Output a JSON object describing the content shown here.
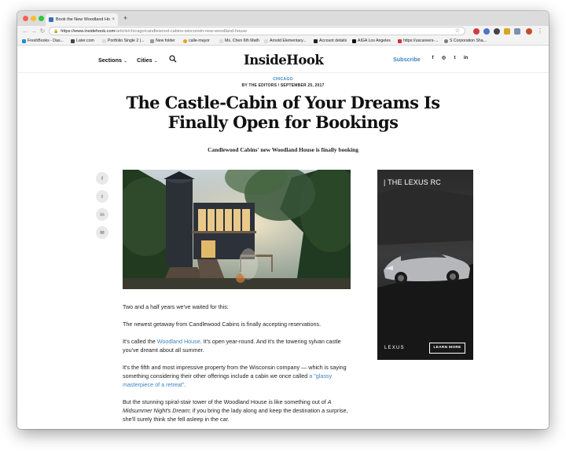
{
  "browser": {
    "tab_title": "Book the New Woodland House",
    "tab_close": "×",
    "new_tab": "+",
    "url_host": "https://www.insidehook.com",
    "url_path": "/article/chicago/candlewood-cabins-wisconsin-new-woodland-house",
    "bookmarks": [
      {
        "label": "FreshBooks - Das...",
        "color": "#1f8fd8"
      },
      {
        "label": "Later.com",
        "color": "#444444"
      },
      {
        "label": "Portfolio Single 2 |...",
        "color": "#bbbbbb"
      },
      {
        "label": "New folder",
        "color": "#9a9a9a"
      },
      {
        "label": "calle-mayor",
        "color": "#e6a21b"
      },
      {
        "label": "Ms. Chen 6th Math",
        "color": "#bbbbbb"
      },
      {
        "label": "Arnold Elementary...",
        "color": "#bbbbbb"
      },
      {
        "label": "Account details",
        "color": "#222222"
      },
      {
        "label": "AIGA Los Angeles",
        "color": "#111111"
      },
      {
        "label": "https://uscareers-...",
        "color": "#d0342c"
      },
      {
        "label": "S Corporation Sha...",
        "color": "#7a7a7a"
      }
    ]
  },
  "site": {
    "nav": {
      "sections": "Sections",
      "cities": "Cities"
    },
    "logo": "InsideHook",
    "subscribe": "Subscribe",
    "social": [
      "f",
      "◎",
      "t",
      "in"
    ]
  },
  "article": {
    "category": "CHICAGO",
    "byline": "BY THE EDITORS / SEPTEMBER 25, 2017",
    "headline": "The Castle-Cabin of Your Dreams Is Finally Open for Bookings",
    "dek": "Candlewood Cabins' new Woodland House is finally booking",
    "share": [
      "f",
      "t",
      "in",
      "✉"
    ],
    "paragraphs": {
      "p1": "Two and a half years we've waited for this:",
      "p2": "The newest getaway from Candlewood Cabins is finally accepting reservations.",
      "p3_a": "It's called the ",
      "p3_link": "Woodland House",
      "p3_b": ". It's open year-round. And it's the towering sylvan castle you've dreamt about all summer.",
      "p4_a": "It's the fifth and most impressive property from the Wisconsin company — which is saying something considering their other offerings include a cabin we once called ",
      "p4_link": "a \"glassy masterpiece of a retreat\"",
      "p4_b": ".",
      "p5_a": "But the stunning spiral-stair tower of the Woodland House is like something out of ",
      "p5_italic": "A Midsummer Night's Dream",
      "p5_b": "; if you bring the lady along and keep the destination a surprise, she'll surely think she fell asleep in the car."
    }
  },
  "ad": {
    "headline": "| THE LEXUS RC",
    "brand": "LEXUS",
    "cta": "LEARN MORE"
  },
  "colors": {
    "accent": "#3c84c4"
  }
}
